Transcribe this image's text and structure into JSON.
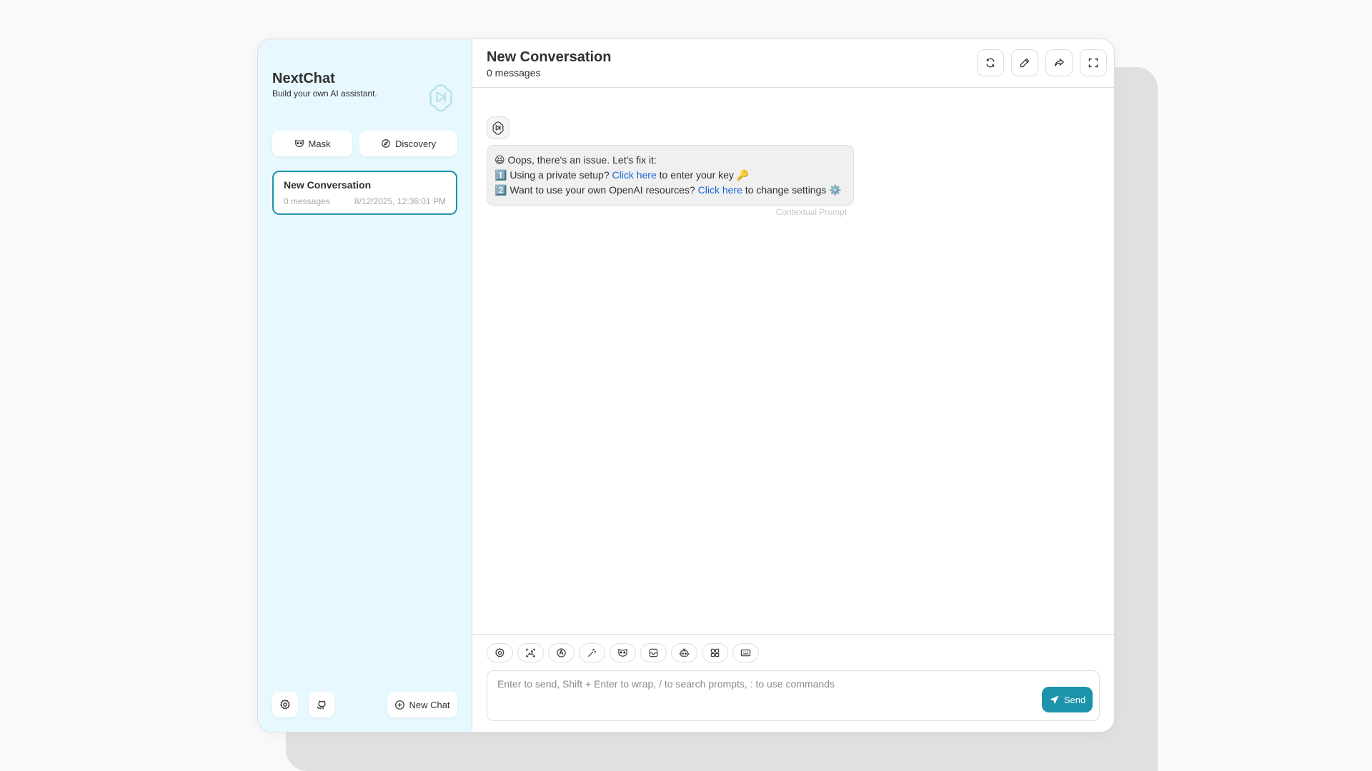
{
  "app": {
    "name": "NextChat",
    "tagline": "Build your own AI assistant."
  },
  "sidebar": {
    "tabs": [
      {
        "label": "Mask",
        "icon": "mask-icon"
      },
      {
        "label": "Discovery",
        "icon": "discovery-icon"
      }
    ],
    "chats": [
      {
        "title": "New Conversation",
        "count": "0 messages",
        "date": "8/12/2025, 12:36:01 PM",
        "selected": true
      }
    ],
    "footer": {
      "settings_icon": "settings-icon",
      "github_icon": "github-icon",
      "new_chat_label": "New Chat"
    }
  },
  "chat": {
    "title": "New Conversation",
    "subtitle": "0 messages",
    "header_actions": [
      "refresh-icon",
      "edit-icon",
      "share-icon",
      "fullscreen-icon"
    ],
    "message": {
      "line1": "😆 Oops, there's an issue. Let's fix it:",
      "line2_pre": "1️⃣ Using a private setup? ",
      "line2_link": "Click here",
      "line2_post": " to enter your key 🔑",
      "line3_pre": "2️⃣ Want to use your own OpenAI resources? ",
      "line3_link": "Click here",
      "line3_post": " to change settings ⚙️",
      "meta": "Contextual Prompt"
    },
    "input": {
      "placeholder": "Enter to send, Shift + Enter to wrap, / to search prompts, : to use commands",
      "send_label": "Send"
    },
    "toolbar_icons": [
      "settings-icon",
      "image-icon",
      "theme-icon",
      "prompt-icon",
      "mask-icon",
      "clear-icon",
      "robot-icon",
      "plugin-icon",
      "shortcut-icon"
    ]
  },
  "colors": {
    "accent": "#1d93ab",
    "sidebar_bg": "#e7f8ff",
    "link": "#1764d6"
  }
}
